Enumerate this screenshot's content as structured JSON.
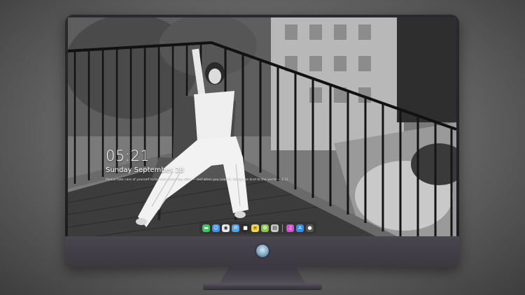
{
  "lock_screen": {
    "time": "05:21",
    "date": "Sunday September 28",
    "quote": "Please take care of yourself today and every day after — rest when you need it, always be kind to the world — 4:21"
  },
  "dock": {
    "apps": [
      {
        "name": "messages-icon",
        "glyph": "▬",
        "color": "#34c759"
      },
      {
        "name": "finder-icon",
        "glyph": "☺",
        "color": "#3b8ff5"
      },
      {
        "name": "safari-icon",
        "glyph": "◉",
        "color": "#e8e8e8"
      },
      {
        "name": "mail-icon",
        "glyph": "✉",
        "color": "#4aa3f0"
      },
      {
        "name": "clapper-icon",
        "glyph": "■",
        "color": "#2b2b2b"
      },
      {
        "name": "notes-icon",
        "glyph": "≡",
        "color": "#f5d547"
      },
      {
        "name": "photos-icon",
        "glyph": "✿",
        "color": "#8bc34a"
      },
      {
        "name": "calendar-icon",
        "glyph": "▤",
        "color": "#c8c8c8"
      },
      {
        "name": "music-icon",
        "glyph": "♫",
        "color": "#d94bd1"
      },
      {
        "name": "app-store-icon",
        "glyph": "A",
        "color": "#2f8ef0"
      },
      {
        "name": "camera-icon",
        "glyph": "●",
        "color": "#555555"
      }
    ]
  },
  "colors": {
    "bezel": "#1c1c20",
    "chin": "#3b3840",
    "screen_bg": "#6f6f6f"
  }
}
